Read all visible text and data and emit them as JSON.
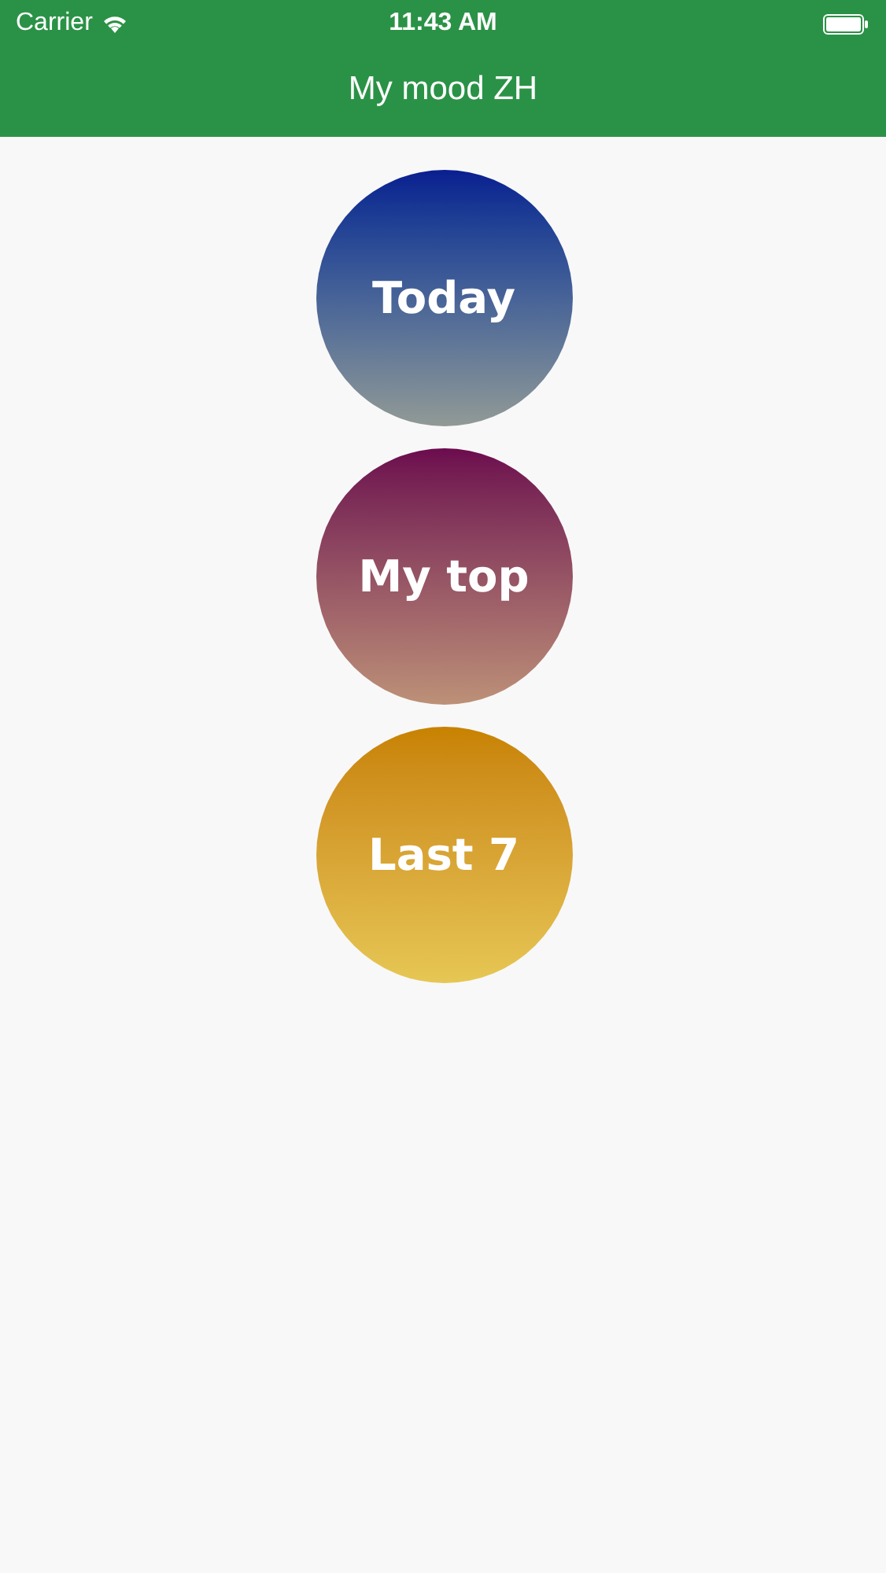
{
  "status_bar": {
    "carrier": "Carrier",
    "time": "11:43 AM"
  },
  "nav_bar": {
    "title": "My mood ZH"
  },
  "buttons": [
    {
      "label": "Today",
      "color": "#0b1e90"
    },
    {
      "label": "My top",
      "color": "#6c0a4e"
    },
    {
      "label": "Last 7",
      "color": "#c88200"
    }
  ]
}
